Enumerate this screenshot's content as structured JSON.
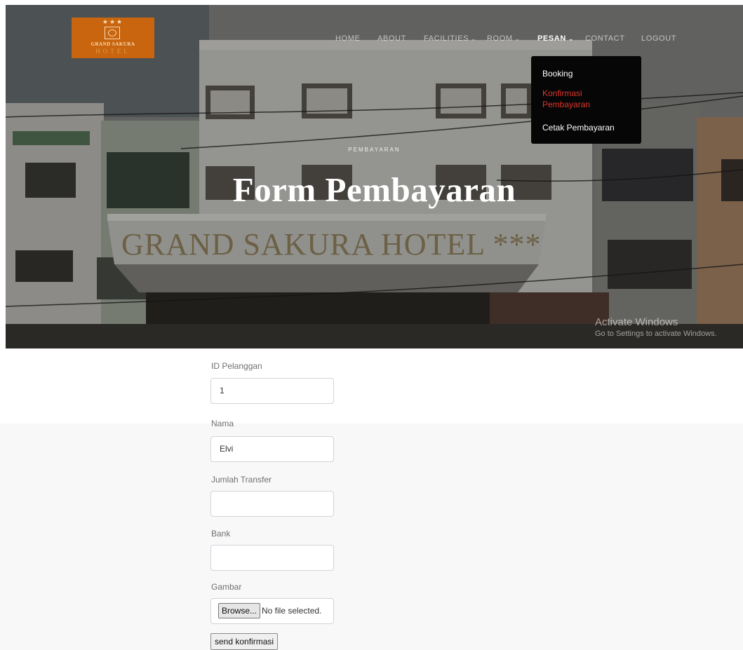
{
  "logo": {
    "stars": "★★★",
    "name": "GRAND SAKURA",
    "sub": "HOTEL"
  },
  "nav": {
    "items": [
      {
        "label": "HOME",
        "has_dropdown": false
      },
      {
        "label": "ABOUT",
        "has_dropdown": false
      },
      {
        "label": "FACILITIES",
        "has_dropdown": true
      },
      {
        "label": "ROOM",
        "has_dropdown": true
      },
      {
        "label": "PESAN",
        "has_dropdown": true,
        "active": true
      },
      {
        "label": "CONTACT",
        "has_dropdown": false
      },
      {
        "label": "LOGOUT",
        "has_dropdown": false
      }
    ],
    "chevron": "⌄"
  },
  "dropdown": {
    "items": [
      {
        "label": "Booking"
      },
      {
        "label": "Konfirmasi",
        "label2": "Pembayaran",
        "highlight": true
      },
      {
        "label": "Cetak Pembayaran"
      }
    ]
  },
  "hero": {
    "subtitle": "PEMBAYARAN",
    "title": "Form Pembayaran",
    "sign_text": "GRAND SAKURA HOTEL ***"
  },
  "watermark": {
    "line1": "Activate Windows",
    "line2": "Go to Settings to activate Windows."
  },
  "form": {
    "id_label": "ID Pelanggan",
    "id_value": "1",
    "nama_label": "Nama",
    "nama_value": "Elvi",
    "jumlah_label": "Jumlah Transfer",
    "jumlah_value": "",
    "bank_label": "Bank",
    "bank_value": "",
    "gambar_label": "Gambar",
    "browse_label": "Browse...",
    "file_status": "No file selected.",
    "submit_label": "send konfirmasi"
  },
  "colors": {
    "logo_bg": "#c8650e",
    "dropdown_bg": "#060606",
    "dropdown_highlight": "#e0352b"
  }
}
